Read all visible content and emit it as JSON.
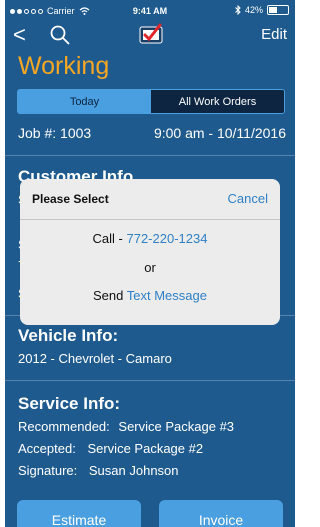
{
  "status_bar": {
    "carrier": "Carrier",
    "time": "9:41 AM",
    "battery_percent": "42%",
    "battery_level": 0.42
  },
  "nav": {
    "back_glyph": "<",
    "edit_label": "Edit"
  },
  "page_title": "Working",
  "tabs": {
    "today": "Today",
    "all": "All Work Orders"
  },
  "job": {
    "number_label": "Job #: 1003",
    "datetime": "9:00 am - 10/11/2016"
  },
  "customer_section": {
    "title": "Customer Info",
    "stub1": "S",
    "stub2": "S",
    "stub3": "7",
    "stub4": "S"
  },
  "vehicle": {
    "title": "Vehicle Info:",
    "details": "2012 - Chevrolet - Camaro"
  },
  "service": {
    "title": "Service Info:",
    "recommended_label": "Recommended:",
    "recommended_value": "Service Package #3",
    "accepted_label": "Accepted:",
    "accepted_value": "Service Package #2",
    "signature_label": "Signature:",
    "signature_value": "Susan Johnson"
  },
  "bottom_buttons": {
    "left": "Estimate",
    "right": "Invoice"
  },
  "modal": {
    "title": "Please Select",
    "cancel": "Cancel",
    "call_prefix": "Call - ",
    "phone": "772-220-1234",
    "or": "or",
    "send_prefix": "Send ",
    "text_message": "Text Message"
  },
  "icons": {
    "back": "back-chevron-icon",
    "search": "search-icon",
    "logo": "checkmark-logo-icon",
    "wifi": "wifi-icon",
    "bluetooth": "bluetooth-icon",
    "battery": "battery-icon"
  },
  "colors": {
    "background": "#1f5a8f",
    "accent": "#f5a623",
    "segment_active": "#4a9fe0",
    "segment_dark": "#0d2540",
    "link": "#2f80c8",
    "modal_bg": "#ececec"
  }
}
